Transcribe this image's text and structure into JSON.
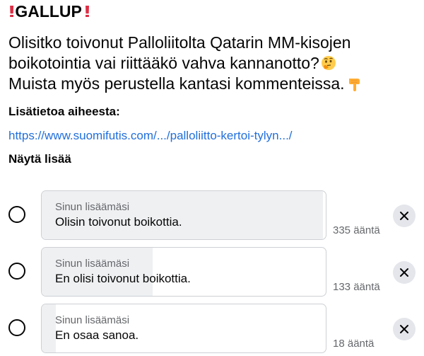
{
  "post": {
    "title": "GALLUP",
    "body_lines": [
      "Olisitko toivonut Palloliitolta Qatarin MM-kisojen",
      "boikotointia vai riittääkö vahva kannanotto?",
      "Muista myös perustella kantasi kommenteissa."
    ],
    "more_info_label": "Lisätietoa aiheesta:",
    "link_text": "https://www.suomifutis.com/.../palloliitto-kertoi-tylyn.../",
    "show_more_label": "Näytä lisää"
  },
  "icons": {
    "title_prefix": "double-exclamation-icon",
    "title_suffix": "double-exclamation-icon",
    "line2_suffix": "thinking-face-icon",
    "line3_suffix": "pointing-down-hand-icon",
    "remove": "close-icon"
  },
  "poll": {
    "options": [
      {
        "added_by": "Sinun lisäämäsi",
        "text": "Olisin toivonut boikottia.",
        "votes": "335 ääntä",
        "share": 0.99
      },
      {
        "added_by": "Sinun lisäämäsi",
        "text": "En olisi toivonut boikottia.",
        "votes": "133 ääntä",
        "share": 0.39
      },
      {
        "added_by": "Sinun lisäämäsi",
        "text": "En osaa sanoa.",
        "votes": "18 ääntä",
        "share": 0.05
      }
    ]
  },
  "colors": {
    "link": "#216fdb",
    "exclamation": "#dd2e44",
    "bar_fill": "#eef0f2",
    "muted_text": "#65676b"
  }
}
